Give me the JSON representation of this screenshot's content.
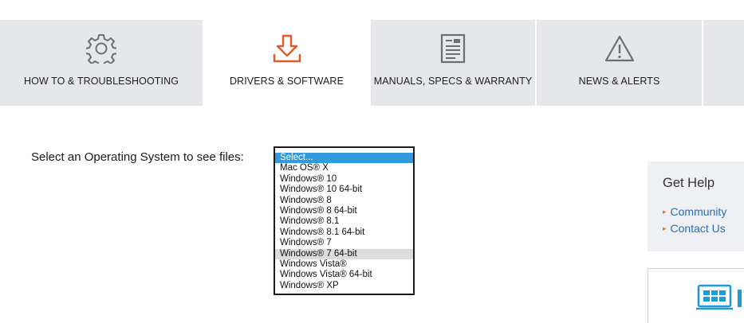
{
  "tabs": [
    {
      "id": "howto",
      "label": "HOW TO & TROUBLESHOOTING",
      "icon": "gear-icon"
    },
    {
      "id": "drivers",
      "label": "DRIVERS & SOFTWARE",
      "icon": "download-icon",
      "active": true
    },
    {
      "id": "manuals",
      "label": "MANUALS, SPECS & WARRANTY",
      "icon": "document-icon"
    },
    {
      "id": "news",
      "label": "NEWS & ALERTS",
      "icon": "warning-icon"
    }
  ],
  "os_select": {
    "label": "Select an Operating System to see files:",
    "options": [
      "Select...",
      "Mac OS® X",
      "Windows® 10",
      "Windows® 10 64-bit",
      "Windows® 8",
      "Windows® 8 64-bit",
      "Windows® 8.1",
      "Windows® 8.1 64-bit",
      "Windows® 7",
      "Windows® 7 64-bit",
      "Windows Vista®",
      "Windows Vista® 64-bit",
      "Windows® XP"
    ],
    "selected_index": 0,
    "hovered_index": 9
  },
  "get_help": {
    "title": "Get Help",
    "links": [
      "Community",
      "Contact Us"
    ]
  },
  "colors": {
    "tab_bg": "#e5e7ea",
    "accent_orange": "#e05a2b",
    "link_blue": "#2a6db5",
    "select_highlight": "#3399dd",
    "promo_icon": "#1e9bd7"
  }
}
